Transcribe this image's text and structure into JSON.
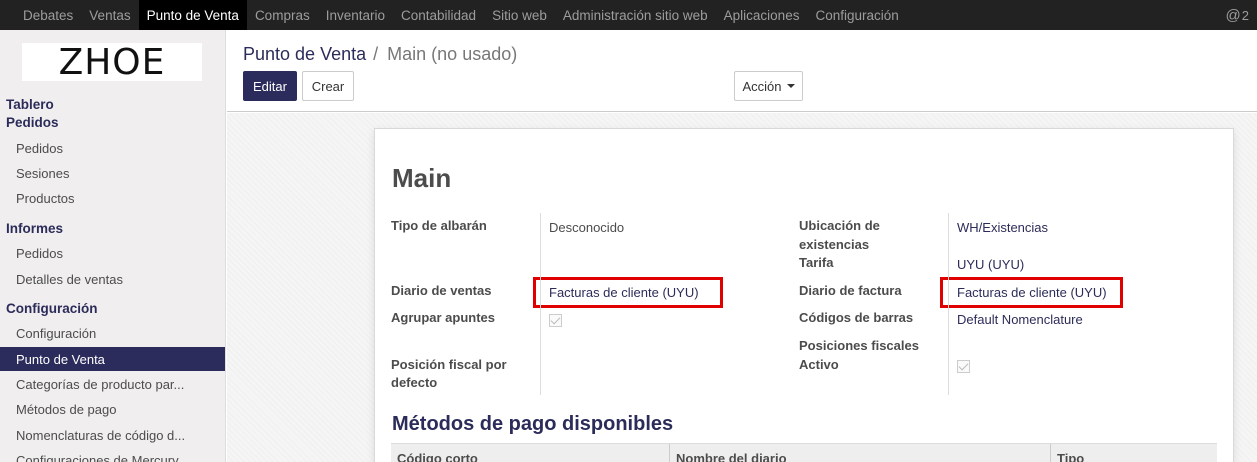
{
  "topbar": {
    "menu": [
      "Debates",
      "Ventas",
      "Punto de Venta",
      "Compras",
      "Inventario",
      "Contabilidad",
      "Sitio web",
      "Administración sitio web",
      "Aplicaciones",
      "Configuración"
    ],
    "active_index": 2,
    "notify_at": "@",
    "notify_count": "2"
  },
  "sidebar": {
    "logo": "ZHOE",
    "sections": {
      "tablero": "Tablero",
      "pedidos": "Pedidos",
      "informes": "Informes",
      "configuracion": "Configuración"
    },
    "pedidos_items": [
      "Pedidos",
      "Sesiones",
      "Productos"
    ],
    "informes_items": [
      "Pedidos",
      "Detalles de ventas"
    ],
    "config_items": [
      "Configuración",
      "Punto de Venta",
      "Categorías de producto par...",
      "Métodos de pago",
      "Nomenclaturas de código d...",
      "Configuraciones de Mercury..."
    ],
    "active_item": "Punto de Venta"
  },
  "control": {
    "breadcrumb_parent": "Punto de Venta",
    "breadcrumb_sep": "/",
    "breadcrumb_current": "Main (no usado)",
    "edit_label": "Editar",
    "create_label": "Crear",
    "action_label": "Acción"
  },
  "form": {
    "title": "Main",
    "left": {
      "tipo_albaran_label": "Tipo de albarán",
      "tipo_albaran_value": "Desconocido",
      "diario_ventas_label": "Diario de ventas",
      "diario_ventas_value": "Facturas de cliente (UYU)",
      "agrupar_apuntes_label": "Agrupar apuntes",
      "agrupar_apuntes_checked": true,
      "posicion_fiscal_label_1": "Posición fiscal por",
      "posicion_fiscal_label_2": "defecto"
    },
    "right": {
      "ubicacion_label_1": "Ubicación de",
      "ubicacion_label_2": "existencias",
      "ubicacion_value": "WH/Existencias",
      "tarifa_label": "Tarifa",
      "tarifa_value": "UYU (UYU)",
      "diario_factura_label": "Diario de factura",
      "diario_factura_value": "Facturas de cliente (UYU)",
      "codigos_barras_label": "Códigos de barras",
      "codigos_barras_value": "Default Nomenclature",
      "posiciones_fiscales_label": "Posiciones fiscales",
      "activo_label": "Activo",
      "activo_checked": true
    },
    "payment_section_title": "Métodos de pago disponibles",
    "payment_columns": [
      "Código corto",
      "Nombre del diario",
      "Tipo"
    ]
  },
  "colors": {
    "navbar": "#222222",
    "brand": "#2b2b5c",
    "highlight": "#e00000"
  }
}
